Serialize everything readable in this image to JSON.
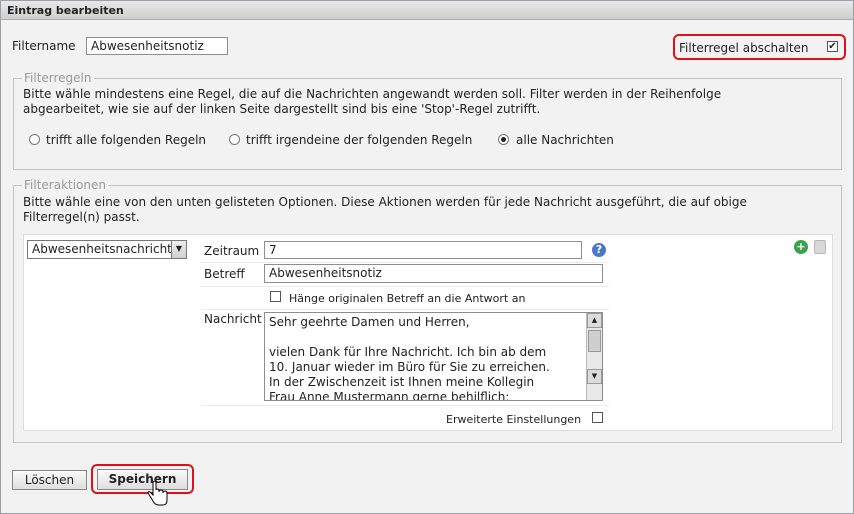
{
  "window": {
    "title": "Eintrag bearbeiten"
  },
  "filter": {
    "name_label": "Filtername",
    "name_value": "Abwesenheitsnotiz",
    "disable_label": "Filterregel abschalten",
    "disable_checked": true
  },
  "rules": {
    "legend": "Filterregeln",
    "description": "Bitte wähle mindestens eine Regel, die auf die Nachrichten angewandt werden soll. Filter werden in der Reihenfolge abgearbeitet, wie sie auf der linken Seite dargestellt sind bis eine 'Stop'-Regel zutrifft.",
    "options": [
      {
        "label": "trifft alle folgenden Regeln",
        "selected": false
      },
      {
        "label": "trifft irgendeine der folgenden Regeln",
        "selected": false
      },
      {
        "label": "alle Nachrichten",
        "selected": true
      }
    ]
  },
  "actions": {
    "legend": "Filteraktionen",
    "description": "Bitte wähle eine von den unten gelisteten Optionen. Diese Aktionen werden für jede Nachricht ausgeführt, die auf obige Filterregel(n) passt.",
    "action_select_value": "Abwesenheitsnachricht",
    "zeitraum_label": "Zeitraum",
    "zeitraum_value": "7",
    "betreff_label": "Betreff",
    "betreff_value": "Abwesenheitsnotiz",
    "append_subject_label": "Hänge originalen Betreff an die Antwort an",
    "append_subject_checked": false,
    "nachricht_label": "Nachricht",
    "nachricht_lines": [
      "Sehr geehrte Damen und Herren,",
      "",
      "vielen Dank für Ihre Nachricht. Ich bin ab dem",
      "10. Januar wieder im Büro für Sie zu erreichen.",
      "In der Zwischenzeit ist Ihnen meine Kollegin",
      "Frau Anne Mustermann gerne behilflich:"
    ],
    "advanced_label": "Erweiterte Einstellungen",
    "advanced_checked": false
  },
  "buttons": {
    "delete_label": "Löschen",
    "save_label": "Speichern"
  },
  "colors": {
    "highlight": "#e0101a",
    "add_icon": "#3aa34a",
    "help_icon": "#4a78c8"
  }
}
